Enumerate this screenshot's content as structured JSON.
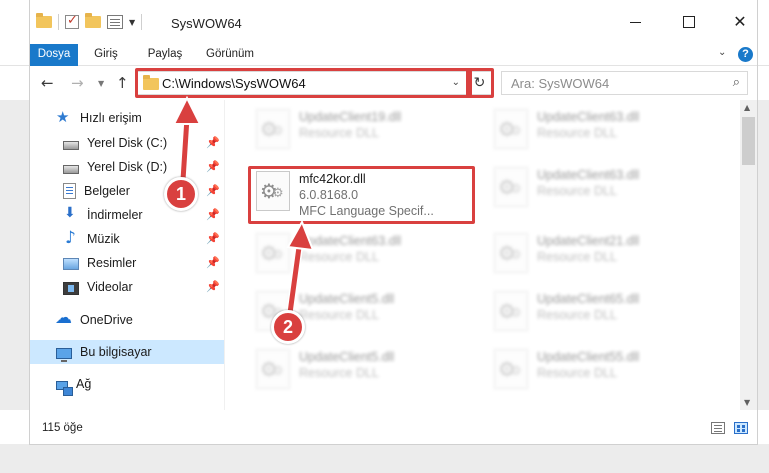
{
  "window": {
    "title": "SysWOW64",
    "controls": {
      "minimize": "",
      "maximize": "",
      "close": "✕"
    }
  },
  "ribbon": {
    "tabs": [
      "Dosya",
      "Giriş",
      "Paylaş",
      "Görünüm"
    ]
  },
  "address_bar": {
    "path": "C:\\Windows\\SysWOW64",
    "search_placeholder": "Ara: SysWOW64"
  },
  "nav_pane": {
    "items": [
      {
        "label": "Hızlı erişim",
        "icon": "star-icon"
      },
      {
        "label": "Yerel Disk (C:)",
        "icon": "disk-icon",
        "pinned": true
      },
      {
        "label": "Yerel Disk (D:)",
        "icon": "disk-icon",
        "pinned": true
      },
      {
        "label": "Belgeler",
        "icon": "document-icon",
        "pinned": true
      },
      {
        "label": "İndirmeler",
        "icon": "download-icon",
        "pinned": true
      },
      {
        "label": "Müzik",
        "icon": "music-icon",
        "pinned": true
      },
      {
        "label": "Resimler",
        "icon": "picture-icon",
        "pinned": true
      },
      {
        "label": "Videolar",
        "icon": "video-icon",
        "pinned": true
      },
      {
        "label": "OneDrive",
        "icon": "cloud-icon"
      },
      {
        "label": "Bu bilgisayar",
        "icon": "computer-icon",
        "selected": true
      },
      {
        "label": "Ağ",
        "icon": "network-icon"
      }
    ],
    "pin_glyph": "📌"
  },
  "files": {
    "left_column": [
      {
        "name": "UpdateClient19.dll",
        "type": "Resource DLL",
        "blurred": true
      },
      {
        "name": "mfc42kor.dll",
        "version": "6.0.8168.0",
        "description": "MFC Language Specif...",
        "blurred": false,
        "highlighted": true
      },
      {
        "name": "UpdateClient63.dll",
        "type": "Resource DLL",
        "blurred": true
      },
      {
        "name": "UpdateClient5.dll",
        "type": "Resource DLL",
        "blurred": true
      },
      {
        "name": "UpdateClient5.dll",
        "type": "Resource DLL",
        "blurred": true
      }
    ],
    "right_column": [
      {
        "name": "UpdateClient63.dll",
        "type": "Resource DLL",
        "blurred": true
      },
      {
        "name": "UpdateClient63.dll",
        "type": "Resource DLL",
        "blurred": true
      },
      {
        "name": "UpdateClient21.dll",
        "type": "Resource DLL",
        "blurred": true
      },
      {
        "name": "UpdateClient65.dll",
        "type": "Resource DLL",
        "blurred": true
      },
      {
        "name": "UpdateClient55.dll",
        "type": "Resource DLL",
        "blurred": true
      }
    ]
  },
  "status_bar": {
    "item_count": "115 öğe"
  },
  "annotations": {
    "step1": "1",
    "step2": "2",
    "highlight_color": "#d9403f"
  },
  "colors": {
    "accent": "#1979ca",
    "selection": "#cce8ff"
  }
}
